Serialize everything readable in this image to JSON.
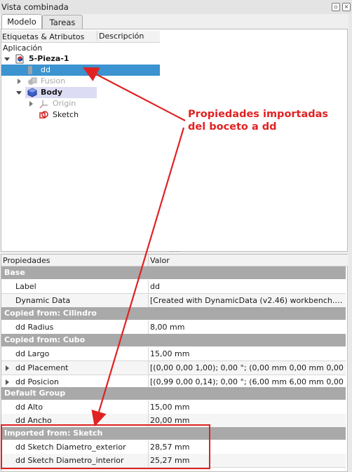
{
  "window": {
    "title": "Vista combinada"
  },
  "tabs": [
    {
      "label": "Modelo"
    },
    {
      "label": "Tareas"
    }
  ],
  "tree": {
    "headers": {
      "col1": "Etiquetas & Atributos",
      "col2": "Descripción"
    },
    "root": "Aplicación",
    "items": [
      {
        "label": "5-Pieza-1",
        "icon": "document-icon"
      },
      {
        "label": "dd",
        "icon": "dynamic-data-icon",
        "selected": true
      },
      {
        "label": "Fusion",
        "icon": "fusion-icon"
      },
      {
        "label": "Body",
        "icon": "body-icon"
      },
      {
        "label": "Origin",
        "icon": "origin-icon"
      },
      {
        "label": "Sketch",
        "icon": "sketch-icon"
      }
    ]
  },
  "annotation": {
    "line1": "Propiedades importadas",
    "line2": "del boceto a dd",
    "color": "#e02222"
  },
  "props": {
    "headers": {
      "col1": "Propiedades",
      "col2": "Valor"
    },
    "groups": [
      {
        "name": "Base",
        "rows": [
          {
            "key": "Label",
            "value": "dd"
          },
          {
            "key": "Dynamic Data",
            "value": "[Created with DynamicData (v2.46) workbench.…"
          }
        ]
      },
      {
        "name": "Copied from: Cilindro",
        "rows": [
          {
            "key": "dd Radius",
            "value": "8,00 mm"
          }
        ]
      },
      {
        "name": "Copied from: Cubo",
        "rows": [
          {
            "key": "dd Largo",
            "value": "15,00 mm"
          },
          {
            "key": "dd Placement",
            "value": "[(0,00 0,00 1,00); 0,00 °; (0,00 mm  0,00 mm  0,00"
          },
          {
            "key": "dd Posicion",
            "value": "[(0,99 0,00 0,14); 0,00 °; (6,00 mm  6,00 mm  0,00"
          }
        ]
      },
      {
        "name": "Default Group",
        "rows": [
          {
            "key": "dd Alto",
            "value": "15,00 mm"
          },
          {
            "key": "dd Ancho",
            "value": "20,00 mm"
          }
        ]
      },
      {
        "name": "Imported from: Sketch",
        "rows": [
          {
            "key": "dd Sketch Diametro_exterior",
            "value": "28,57 mm"
          },
          {
            "key": "dd Sketch Diametro_interior",
            "value": "25,27 mm"
          }
        ]
      }
    ]
  }
}
